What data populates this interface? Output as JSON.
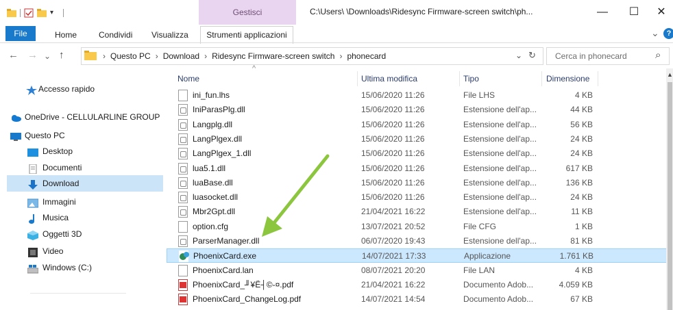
{
  "window": {
    "context_tab": "Gestisci",
    "title": "C:\\Users\\          \\Downloads\\Ridesync Firmware-screen switch\\ph...",
    "min": "—",
    "max": "☐",
    "close": "✕"
  },
  "ribbon": {
    "tabs": [
      "File",
      "Home",
      "Condividi",
      "Visualizza",
      "Strumenti applicazioni"
    ],
    "expand": "⌄",
    "help": "?"
  },
  "nav": {
    "back": "←",
    "forward": "→",
    "recent": "⌄",
    "up": "↑",
    "crumbs": [
      "Questo PC",
      "Download",
      "Ridesync Firmware-screen switch",
      "phonecard"
    ],
    "sep": "›",
    "dropdown": "⌄",
    "refresh": "↻",
    "search_placeholder": "Cerca in phonecard",
    "search_icon": "⌕"
  },
  "sidebar": {
    "items": [
      {
        "label": "Accesso rapido",
        "icon": "star-icon"
      },
      {
        "label": "OneDrive - CELLULARLINE GROUP",
        "icon": "cloud-icon"
      },
      {
        "label": "Questo PC",
        "icon": "computer-icon"
      },
      {
        "label": "Desktop",
        "icon": "desktop-icon"
      },
      {
        "label": "Documenti",
        "icon": "documents-icon"
      },
      {
        "label": "Download",
        "icon": "download-icon"
      },
      {
        "label": "Immagini",
        "icon": "pictures-icon"
      },
      {
        "label": "Musica",
        "icon": "music-icon"
      },
      {
        "label": "Oggetti 3D",
        "icon": "objects-3d-icon"
      },
      {
        "label": "Video",
        "icon": "video-icon"
      },
      {
        "label": "Windows (C:)",
        "icon": "drive-icon"
      }
    ]
  },
  "columns": {
    "name": "Nome",
    "date": "Ultima modifica",
    "type": "Tipo",
    "size": "Dimensione",
    "sort_arrow": "^"
  },
  "files": [
    {
      "name": "ini_fun.lhs",
      "date": "15/06/2020 11:26",
      "type": "File LHS",
      "size": "4 KB",
      "kind": "plain"
    },
    {
      "name": "IniParasPlg.dll",
      "date": "15/06/2020 11:26",
      "type": "Estensione dell'ap...",
      "size": "44 KB",
      "kind": "dll"
    },
    {
      "name": "Langplg.dll",
      "date": "15/06/2020 11:26",
      "type": "Estensione dell'ap...",
      "size": "56 KB",
      "kind": "dll"
    },
    {
      "name": "LangPlgex.dll",
      "date": "15/06/2020 11:26",
      "type": "Estensione dell'ap...",
      "size": "24 KB",
      "kind": "dll"
    },
    {
      "name": "LangPlgex_1.dll",
      "date": "15/06/2020 11:26",
      "type": "Estensione dell'ap...",
      "size": "24 KB",
      "kind": "dll"
    },
    {
      "name": "lua5.1.dll",
      "date": "15/06/2020 11:26",
      "type": "Estensione dell'ap...",
      "size": "617 KB",
      "kind": "dll"
    },
    {
      "name": "luaBase.dll",
      "date": "15/06/2020 11:26",
      "type": "Estensione dell'ap...",
      "size": "136 KB",
      "kind": "dll"
    },
    {
      "name": "luasocket.dll",
      "date": "15/06/2020 11:26",
      "type": "Estensione dell'ap...",
      "size": "24 KB",
      "kind": "dll"
    },
    {
      "name": "Mbr2Gpt.dll",
      "date": "21/04/2021 16:22",
      "type": "Estensione dell'ap...",
      "size": "11 KB",
      "kind": "dll"
    },
    {
      "name": "option.cfg",
      "date": "13/07/2021 20:52",
      "type": "File CFG",
      "size": "1 KB",
      "kind": "plain"
    },
    {
      "name": "ParserManager.dll",
      "date": "06/07/2020 19:43",
      "type": "Estensione dell'ap...",
      "size": "81 KB",
      "kind": "dll"
    },
    {
      "name": "PhoenixCard.exe",
      "date": "14/07/2021 17:33",
      "type": "Applicazione",
      "size": "1.761 KB",
      "kind": "exe",
      "selected": true
    },
    {
      "name": "PhoenixCard.lan",
      "date": "08/07/2021 20:20",
      "type": "File LAN",
      "size": "4 KB",
      "kind": "plain"
    },
    {
      "name": "PhoenixCard_╜¥Ё┤©-¤.pdf",
      "date": "21/04/2021 16:22",
      "type": "Documento Adob...",
      "size": "4.059 KB",
      "kind": "pdf"
    },
    {
      "name": "PhoenixCard_ChangeLog.pdf",
      "date": "14/07/2021 14:54",
      "type": "Documento Adob...",
      "size": "67 KB",
      "kind": "pdf"
    }
  ],
  "annotation": {
    "arrow_color": "#8cc63f"
  },
  "colors": {
    "accent": "#1979ca",
    "selection": "#cce8ff",
    "context_tab": "#ead5f0"
  }
}
